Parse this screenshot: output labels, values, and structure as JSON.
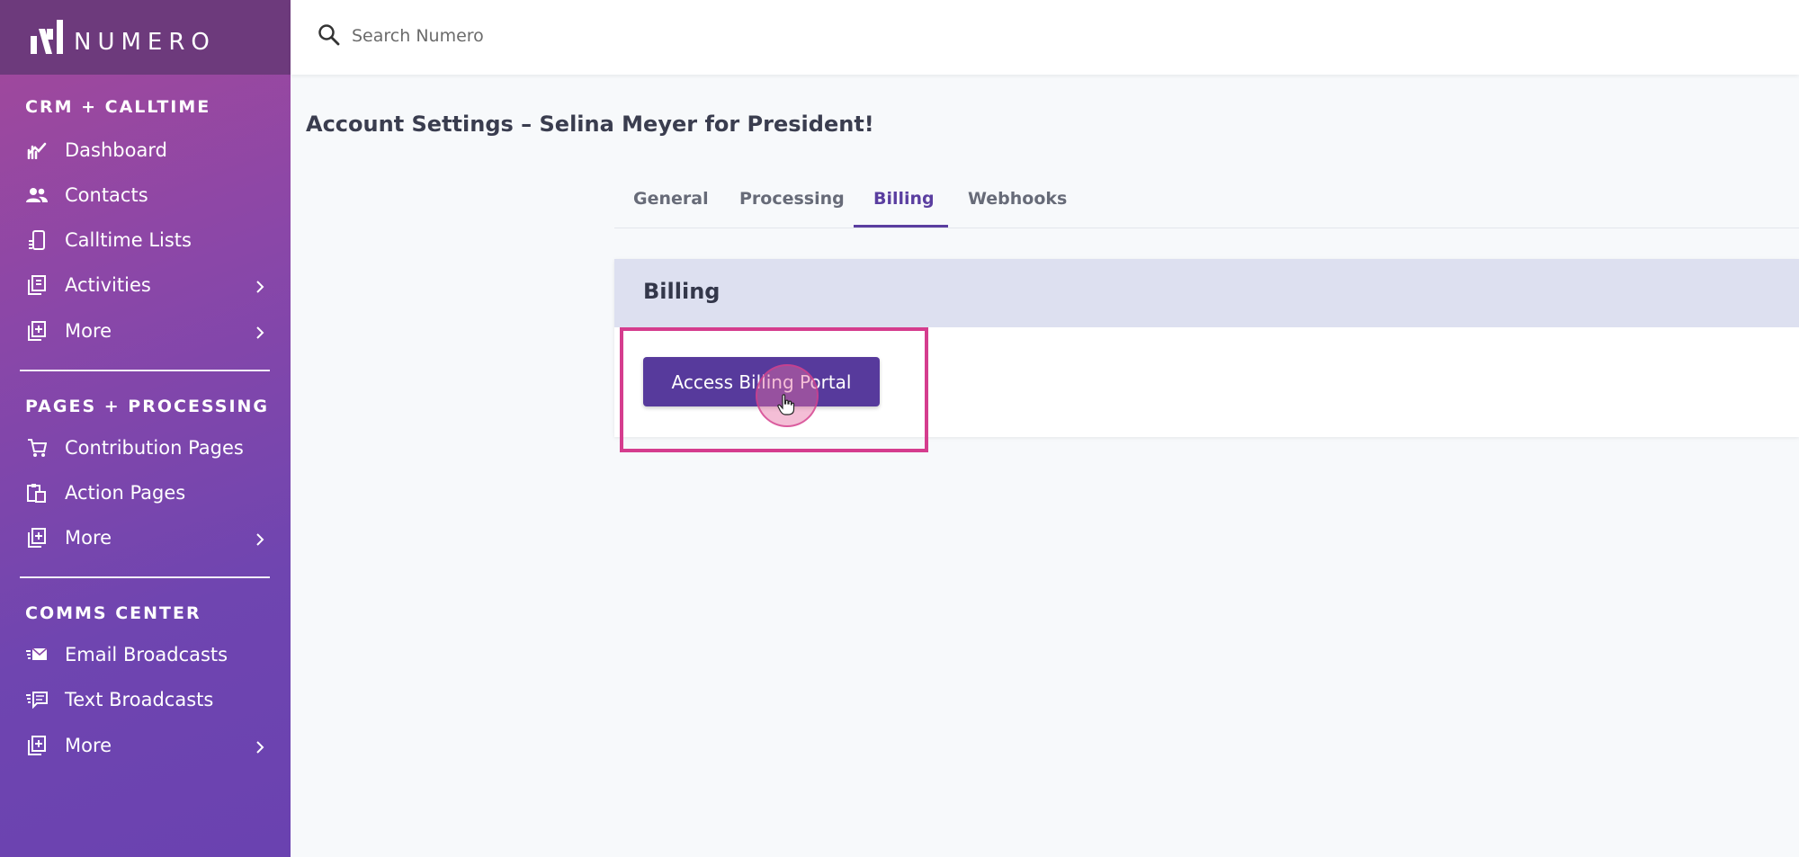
{
  "app": {
    "brand": "NUMERO"
  },
  "search": {
    "placeholder": "Search Numero"
  },
  "sidebar": {
    "sections": [
      {
        "title": "CRM + CALLTIME",
        "items": [
          {
            "label": "Dashboard",
            "icon": "chart-icon"
          },
          {
            "label": "Contacts",
            "icon": "users-icon"
          },
          {
            "label": "Calltime Lists",
            "icon": "phone-list-icon"
          },
          {
            "label": "Activities",
            "icon": "clipboard-icon",
            "expandable": true
          },
          {
            "label": "More",
            "icon": "plus-square-icon",
            "expandable": true
          }
        ]
      },
      {
        "title": "PAGES + PROCESSING",
        "items": [
          {
            "label": "Contribution Pages",
            "icon": "cart-icon"
          },
          {
            "label": "Action Pages",
            "icon": "clipboard-copy-icon"
          },
          {
            "label": "More",
            "icon": "plus-square-icon",
            "expandable": true
          }
        ]
      },
      {
        "title": "COMMS CENTER",
        "items": [
          {
            "label": "Email Broadcasts",
            "icon": "email-icon"
          },
          {
            "label": "Text Broadcasts",
            "icon": "message-icon"
          },
          {
            "label": "More",
            "icon": "plus-square-icon",
            "expandable": true
          }
        ]
      }
    ]
  },
  "page": {
    "title": "Account Settings – Selina Meyer for President!"
  },
  "tabs": [
    {
      "label": "General"
    },
    {
      "label": "Processing"
    },
    {
      "label": "Billing",
      "active": true
    },
    {
      "label": "Webhooks"
    }
  ],
  "billing": {
    "title": "Billing",
    "button_label": "Access Billing Portal"
  },
  "colors": {
    "accent": "#573a9c",
    "highlight": "#d53d8e"
  }
}
